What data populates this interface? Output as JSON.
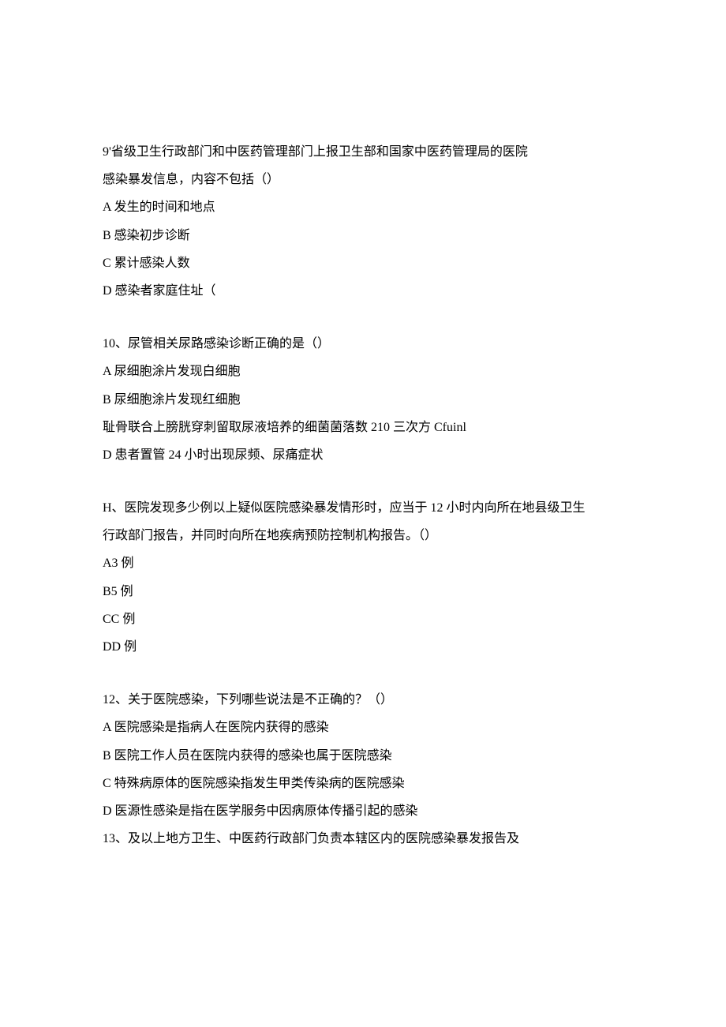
{
  "questions": [
    {
      "stem_line1": "9'省级卫生行政部门和中医药管理部门上报卫生部和国家中医药管理局的医院",
      "stem_line2": "感染暴发信息，内容不包括（）",
      "options": [
        "A 发生的时间和地点",
        "B 感染初步诊断",
        "C 累计感染人数",
        "D 感染者家庭住址（"
      ]
    },
    {
      "stem_line1": "10、尿管相关尿路感染诊断正确的是（）",
      "options": [
        "A 尿细胞涂片发现白细胞",
        "B 尿细胞涂片发现红细胞",
        "耻骨联合上膀胱穿刺留取尿液培养的细菌菌落数 210 三次方 Cfuinl",
        "D 患者置管 24 小时出现尿频、尿痛症状"
      ]
    },
    {
      "stem_line1": "H、医院发现多少例以上疑似医院感染暴发情形时，应当于 12 小时内向所在地县级卫生",
      "stem_line2": "行政部门报告，并同时向所在地疾病预防控制机构报告。（）",
      "options": [
        "A3 例",
        "B5 例",
        "CC 例",
        "DD 例"
      ]
    },
    {
      "stem_line1": "12、关于医院感染，下列哪些说法是不正确的？（）",
      "options": [
        "A 医院感染是指病人在医院内获得的感染",
        "B 医院工作人员在医院内获得的感染也属于医院感染",
        "C 特殊病原体的医院感染指发生甲类传染病的医院感染",
        "D 医源性感染是指在医学服务中因病原体传播引起的感染"
      ],
      "trailing": "13、及以上地方卫生、中医药行政部门负责本辖区内的医院感染暴发报告及"
    }
  ]
}
